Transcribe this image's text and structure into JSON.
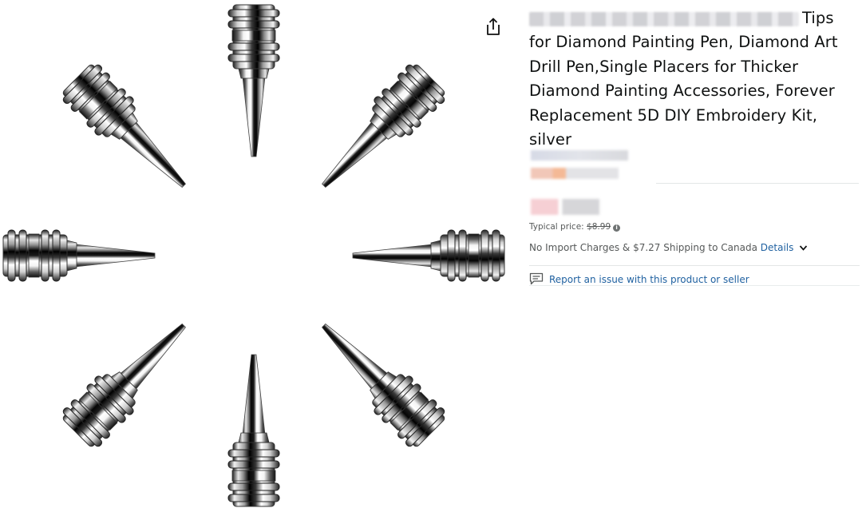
{
  "product": {
    "title_visible": "Tips for Diamond Painting Pen, Diamond Art Drill Pen,Single Placers for Thicker Diamond Painting Accessories, Forever Replacement 5D DIY Embroidery Kit, silver",
    "image_alt": "Silver diamond painting pen tips arranged in a radial star pattern"
  },
  "pricing": {
    "typical_label": "Typical price:",
    "typical_value": "$8.99"
  },
  "shipping": {
    "text": "No Import Charges & $7.27 Shipping to Canada",
    "details_label": "Details"
  },
  "report": {
    "label": "Report an issue with this product or seller"
  },
  "icons": {
    "share": "share-icon",
    "info": "info-icon",
    "chevron": "chevron-down-icon",
    "report": "message-report-icon"
  },
  "colors": {
    "link": "#2162a1",
    "text": "#0f1111",
    "secondary_text": "#565959"
  }
}
